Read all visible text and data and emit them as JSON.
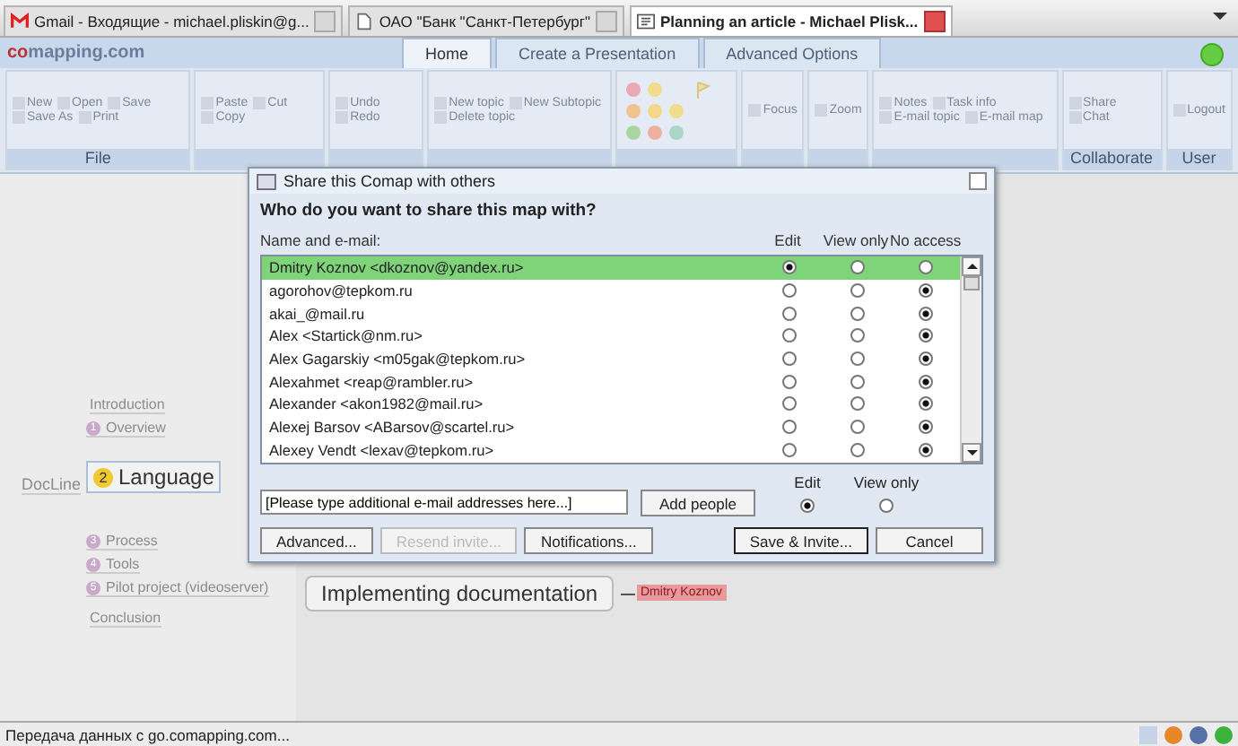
{
  "browser_tabs": [
    {
      "title": "Gmail - Входящие - michael.pliskin@g...",
      "selected": false
    },
    {
      "title": "ОАО \"Банк \"Санкт-Петербург\"",
      "selected": false
    },
    {
      "title": "Planning an article - Michael Plisk...",
      "selected": true
    }
  ],
  "app": {
    "logo_accent": "co",
    "logo_rest": "mapping.com",
    "tabs": [
      {
        "label": "Home",
        "selected": true
      },
      {
        "label": "Create a Presentation",
        "selected": false
      },
      {
        "label": "Advanced Options",
        "selected": false
      }
    ],
    "ribbon_groups": [
      {
        "kind": "buttons",
        "label": "File",
        "items": [
          "New",
          "Open",
          "Save",
          "Save As",
          "Print"
        ]
      },
      {
        "kind": "buttons",
        "items": [
          "Paste",
          "Cut",
          "Copy"
        ]
      },
      {
        "kind": "buttons",
        "items": [
          "Undo",
          "Redo"
        ]
      },
      {
        "kind": "buttons",
        "items": [
          "New topic",
          "New Subtopic",
          "Delete topic"
        ]
      },
      {
        "kind": "palette"
      },
      {
        "kind": "buttons",
        "items": [
          "Focus"
        ]
      },
      {
        "kind": "buttons",
        "items": [
          "Zoom"
        ]
      },
      {
        "kind": "buttons",
        "items": [
          "Notes",
          "Task info",
          "E-mail topic",
          "E-mail map"
        ]
      },
      {
        "kind": "buttons",
        "label": "Collaborate",
        "items": [
          "Share",
          "Chat"
        ]
      },
      {
        "kind": "buttons",
        "label": "User",
        "items": [
          "Logout"
        ]
      }
    ]
  },
  "map": {
    "nodes": [
      {
        "text": "Introduction",
        "kind": "topic"
      },
      {
        "text": "Overview",
        "badge": "1",
        "kind": "topic"
      },
      {
        "text": "DocLine",
        "kind": "root"
      },
      {
        "text": "Language",
        "badge": "2",
        "kind": "main"
      },
      {
        "text": "Process",
        "badge": "3",
        "kind": "topic"
      },
      {
        "text": "Tools",
        "badge": "4",
        "kind": "topic"
      },
      {
        "text": "Pilot project (videoserver)",
        "badge": "5",
        "kind": "topic"
      },
      {
        "text": "Conclusion",
        "kind": "topic"
      },
      {
        "text": "Implementing documentation",
        "kind": "big"
      }
    ],
    "tag": "Dmitry Koznov"
  },
  "dialog": {
    "title": "Share this Comap with others",
    "question": "Who do you want to share this map with?",
    "columns": [
      "Name and e-mail:",
      "Edit",
      "View only",
      "No access"
    ],
    "people": [
      {
        "name": "Dmitry Koznov <dkoznov@yandex.ru>",
        "edit": true,
        "view_only": false,
        "no_access": false,
        "selected": true
      },
      {
        "name": "agorohov@tepkom.ru",
        "edit": false,
        "view_only": false,
        "no_access": true,
        "selected": false
      },
      {
        "name": "akai_@mail.ru",
        "edit": false,
        "view_only": false,
        "no_access": true,
        "selected": false
      },
      {
        "name": "Alex <Startick@nm.ru>",
        "edit": false,
        "view_only": false,
        "no_access": true,
        "selected": false
      },
      {
        "name": "Alex Gagarskiy <m05gak@tepkom.ru>",
        "edit": false,
        "view_only": false,
        "no_access": true,
        "selected": false
      },
      {
        "name": "Alexahmet <reap@rambler.ru>",
        "edit": false,
        "view_only": false,
        "no_access": true,
        "selected": false
      },
      {
        "name": "Alexander <akon1982@mail.ru>",
        "edit": false,
        "view_only": false,
        "no_access": true,
        "selected": false
      },
      {
        "name": "Alexej Barsov <ABarsov@scartel.ru>",
        "edit": false,
        "view_only": false,
        "no_access": true,
        "selected": false
      },
      {
        "name": "Alexey Vendt <lexav@tepkom.ru>",
        "edit": false,
        "view_only": false,
        "no_access": true,
        "selected": false
      }
    ],
    "new_access": [
      {
        "label": "Edit",
        "selected": true
      },
      {
        "label": "View only",
        "selected": false
      }
    ],
    "email_field": {
      "value": "[Please type additional e-mail addresses here...]"
    },
    "add_button": "Add people",
    "buttons": [
      {
        "label": "Advanced...",
        "disabled": false,
        "primary": false
      },
      {
        "label": "Resend invite...",
        "disabled": true,
        "primary": false
      },
      {
        "label": "Notifications...",
        "disabled": false,
        "primary": false
      },
      {
        "label": "Save & Invite...",
        "disabled": false,
        "primary": true
      },
      {
        "label": "Cancel",
        "disabled": false,
        "primary": false
      }
    ]
  },
  "status_bar": {
    "text": "Передача данных с go.comapping.com..."
  }
}
